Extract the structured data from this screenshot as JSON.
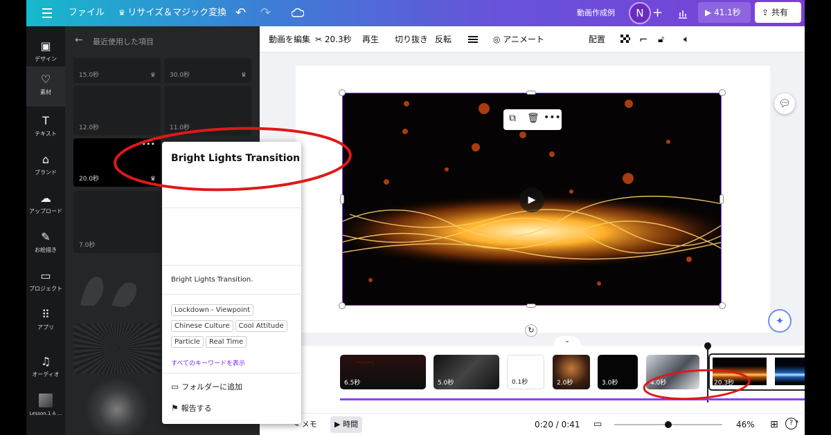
{
  "topbar": {
    "file_label": "ファイル",
    "resize_label": "リサイズ＆マジック変換",
    "doc_title": "動画作成例",
    "avatar_letter": "N",
    "play_duration": "41.1秒",
    "share_label": "共有",
    "gradient_colors": [
      "#16b9cc",
      "#6753d9",
      "#7a3fd8"
    ]
  },
  "sidebar": {
    "items": [
      {
        "label": "デザイン",
        "icon": "design-icon"
      },
      {
        "label": "素材",
        "icon": "elements-icon"
      },
      {
        "label": "テキスト",
        "icon": "text-icon"
      },
      {
        "label": "ブランド",
        "icon": "brand-icon"
      },
      {
        "label": "アップロード",
        "icon": "upload-icon"
      },
      {
        "label": "お絵描き",
        "icon": "draw-icon"
      },
      {
        "label": "プロジェクト",
        "icon": "folder-icon"
      },
      {
        "label": "アプリ",
        "icon": "apps-icon"
      },
      {
        "label": "オーディオ",
        "icon": "music-icon"
      },
      {
        "label": "Lesson.1 A ...",
        "icon": "project-thumbnail"
      }
    ]
  },
  "panel": {
    "back_title": "最近使用した項目",
    "thumbs": [
      {
        "duration": "15.0秒"
      },
      {
        "duration": "30.0秒"
      },
      {
        "duration": "12.0秒"
      },
      {
        "duration": "11.0秒"
      },
      {
        "duration": "20.0秒"
      },
      {
        "duration": "7.0秒"
      }
    ]
  },
  "popup": {
    "title": "Bright Lights Transition",
    "description": "Bright Lights Transition.",
    "tags": [
      "Lockdown - Viewpoint",
      "Chinese Culture",
      "Cool Attitude",
      "Particle",
      "Real Time"
    ],
    "show_all_keywords": "すべてのキーワードを表示",
    "add_to_folder": "フォルダーに追加",
    "report": "報告する"
  },
  "toolbar": {
    "edit_video": "動画を編集",
    "cut_duration": "20.3秒",
    "playback": "再生",
    "crop": "切り抜き",
    "flip": "反転",
    "animate": "アニメート",
    "position": "配置"
  },
  "timeline": {
    "clips": [
      {
        "duration": "6.5秒"
      },
      {
        "duration": "5.0秒"
      },
      {
        "duration": "0.1秒"
      },
      {
        "duration": "2.0秒"
      },
      {
        "duration": "3.0秒"
      },
      {
        "duration": "4.0秒"
      },
      {
        "duration": "20.3秒"
      }
    ],
    "accent_color": "#8b3dff"
  },
  "bottombar": {
    "notes_label": "メモ",
    "timeline_label": "時間",
    "time_readout": "0:20 / 0:41",
    "zoom": "46%",
    "zoom_level": 0.5
  }
}
